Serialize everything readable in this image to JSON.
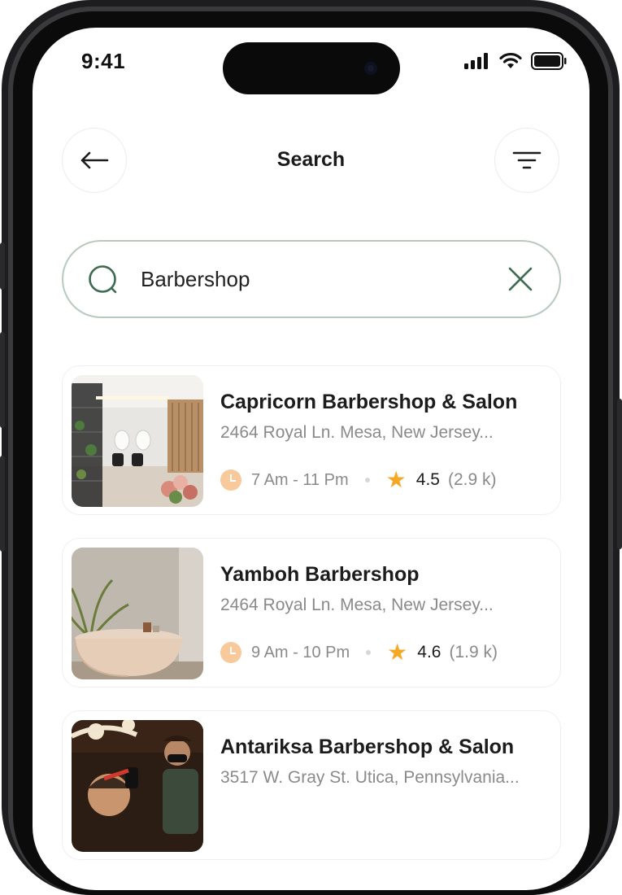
{
  "status_bar": {
    "time": "9:41"
  },
  "header": {
    "title": "Search"
  },
  "search": {
    "value": "Barbershop"
  },
  "results": [
    {
      "name": "Capricorn Barbershop & Salon",
      "address": "2464 Royal Ln. Mesa, New Jersey...",
      "hours": "7 Am - 11 Pm",
      "rating": "4.5",
      "reviews": "(2.9 k)"
    },
    {
      "name": "Yamboh Barbershop",
      "address": "2464 Royal Ln. Mesa, New Jersey...",
      "hours": "9 Am - 10 Pm",
      "rating": "4.6",
      "reviews": "(1.9 k)"
    },
    {
      "name": "Antariksa Barbershop & Salon",
      "address": "3517 W. Gray St. Utica, Pennsylvania...",
      "hours": "",
      "rating": "",
      "reviews": ""
    }
  ],
  "colors": {
    "accent_green": "#3d6b4f",
    "search_border": "#b8c9bd",
    "star": "#f6a824",
    "clock": "#f7c99b"
  },
  "icons": [
    "back-arrow-icon",
    "filter-icon",
    "search-icon",
    "close-icon",
    "clock-icon",
    "star-icon",
    "signal-icon",
    "wifi-icon",
    "battery-icon"
  ]
}
